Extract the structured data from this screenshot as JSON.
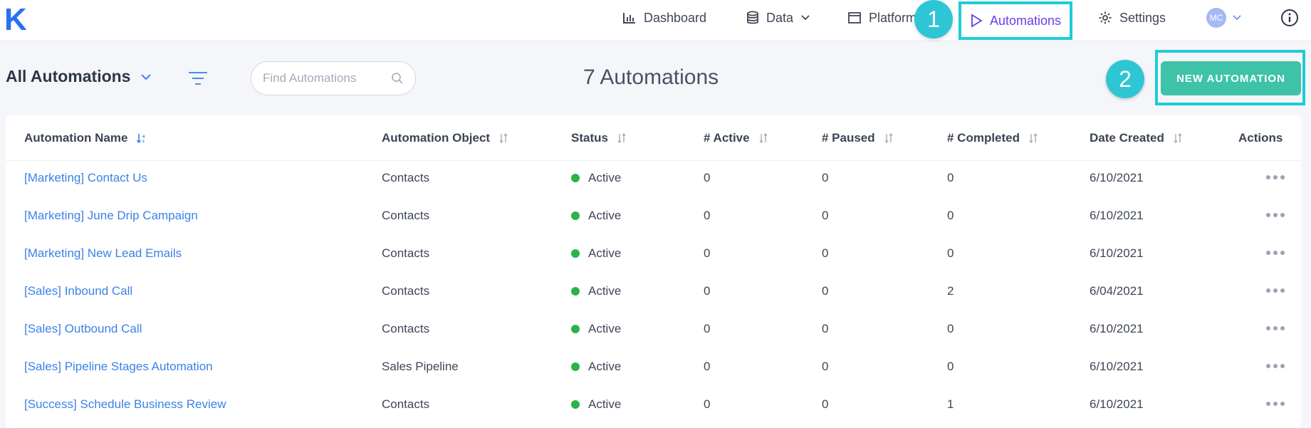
{
  "app": {
    "logo": "K"
  },
  "nav": {
    "dashboard": "Dashboard",
    "data": "Data",
    "platform": "Platform",
    "automations": "Automations",
    "settings": "Settings",
    "user_initials": "MC"
  },
  "callouts": {
    "one": "1",
    "two": "2"
  },
  "toolbar": {
    "view_label": "All Automations",
    "search_placeholder": "Find Automations",
    "count_label": "7 Automations",
    "new_button": "NEW AUTOMATION"
  },
  "table": {
    "headers": [
      "Automation Name",
      "Automation Object",
      "Status",
      "# Active",
      "# Paused",
      "# Completed",
      "Date Created",
      "Actions"
    ],
    "rows": [
      {
        "name": "[Marketing] Contact Us",
        "object": "Contacts",
        "status": "Active",
        "active": "0",
        "paused": "0",
        "completed": "0",
        "date": "6/10/2021"
      },
      {
        "name": "[Marketing] June Drip Campaign",
        "object": "Contacts",
        "status": "Active",
        "active": "0",
        "paused": "0",
        "completed": "0",
        "date": "6/10/2021"
      },
      {
        "name": "[Marketing] New Lead Emails",
        "object": "Contacts",
        "status": "Active",
        "active": "0",
        "paused": "0",
        "completed": "0",
        "date": "6/10/2021"
      },
      {
        "name": "[Sales] Inbound Call",
        "object": "Contacts",
        "status": "Active",
        "active": "0",
        "paused": "0",
        "completed": "2",
        "date": "6/04/2021"
      },
      {
        "name": "[Sales] Outbound Call",
        "object": "Contacts",
        "status": "Active",
        "active": "0",
        "paused": "0",
        "completed": "0",
        "date": "6/10/2021"
      },
      {
        "name": "[Sales] Pipeline Stages Automation",
        "object": "Sales Pipeline",
        "status": "Active",
        "active": "0",
        "paused": "0",
        "completed": "0",
        "date": "6/10/2021"
      },
      {
        "name": "[Success] Schedule Business Review",
        "object": "Contacts",
        "status": "Active",
        "active": "0",
        "paused": "0",
        "completed": "1",
        "date": "6/10/2021"
      }
    ]
  },
  "colors": {
    "brand": "#2a6ff3",
    "accent_purple": "#6a3ee8",
    "highlight_cyan": "#1fcbd8",
    "button_green": "#3ec3a9",
    "link_blue": "#3b82e6",
    "status_active": "#2bb24c"
  },
  "icons": {
    "dashboard": "bar-chart-icon",
    "data": "database-icon",
    "platform": "window-icon",
    "automations": "play-triangle-icon",
    "settings": "gear-icon",
    "info": "info-icon",
    "filter": "filter-lines-icon",
    "search": "search-icon",
    "sort": "sort-arrows-icon",
    "actions": "more-dots-icon"
  }
}
